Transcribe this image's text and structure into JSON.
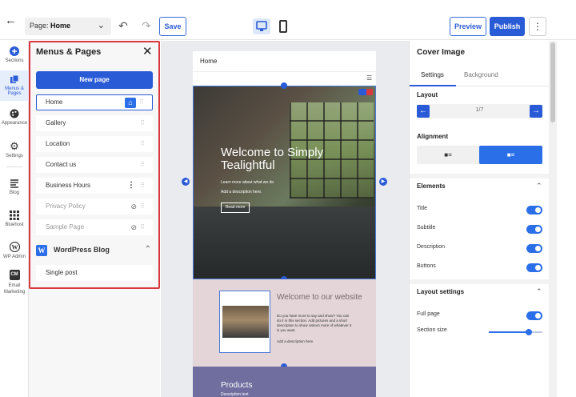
{
  "toolbar": {
    "page_prefix": "Page:",
    "page_name": "Home",
    "save_label": "Save",
    "preview_label": "Preview",
    "publish_label": "Publish"
  },
  "rail": {
    "items": [
      {
        "label": "Sections",
        "icon": "plus-circle-icon"
      },
      {
        "label": "Menus & Pages",
        "icon": "pages-icon"
      },
      {
        "label": "Appearance",
        "icon": "palette-icon"
      },
      {
        "label": "Settings",
        "icon": "gear-icon"
      },
      {
        "label": "Blog",
        "icon": "blog-icon"
      },
      {
        "label": "Bluehost",
        "icon": "grid-icon"
      },
      {
        "label": "WP Admin",
        "icon": "wordpress-icon"
      },
      {
        "label": "Email Marketing",
        "icon": "cm-icon",
        "badge": "CM"
      }
    ]
  },
  "panel": {
    "title": "Menus & Pages",
    "new_page_label": "New page",
    "pages": [
      {
        "label": "Home"
      },
      {
        "label": "Gallery"
      },
      {
        "label": "Location"
      },
      {
        "label": "Contact us"
      },
      {
        "label": "Business Hours"
      },
      {
        "label": "Privacy Policy"
      },
      {
        "label": "Sample Page"
      }
    ],
    "blog_section": "WordPress Blog",
    "blog_items": [
      {
        "label": "Single post"
      }
    ]
  },
  "site": {
    "header_title": "Home",
    "cover": {
      "title": "Welcome to Simply Tealightful",
      "subtitle": "Learn more about what we do",
      "description": "Add a description here.",
      "button": "Read more"
    },
    "welcome": {
      "title": "Welcome to our website",
      "body": "Do you have more to say and show? You can do it in this section. Add pictures and a short description to show visitors more of whatever it is you want.",
      "add": "Add a description here."
    },
    "products": {
      "title": "Products",
      "sub": "Description text"
    }
  },
  "right": {
    "title": "Cover Image",
    "tabs": [
      "Settings",
      "Background"
    ],
    "layout_label": "Layout",
    "layout_count": "1/7",
    "alignment_label": "Alignment",
    "elements_label": "Elements",
    "elements": [
      {
        "label": "Title",
        "on": true
      },
      {
        "label": "Subtitle",
        "on": true
      },
      {
        "label": "Description",
        "on": true
      },
      {
        "label": "Buttons",
        "on": true
      }
    ],
    "layout_settings_label": "Layout settings",
    "full_page_label": "Full page",
    "section_size_label": "Section size",
    "section_size_value": 0.75
  },
  "colors": {
    "accent": "#2a5bd7",
    "highlight": "#d9393e"
  }
}
